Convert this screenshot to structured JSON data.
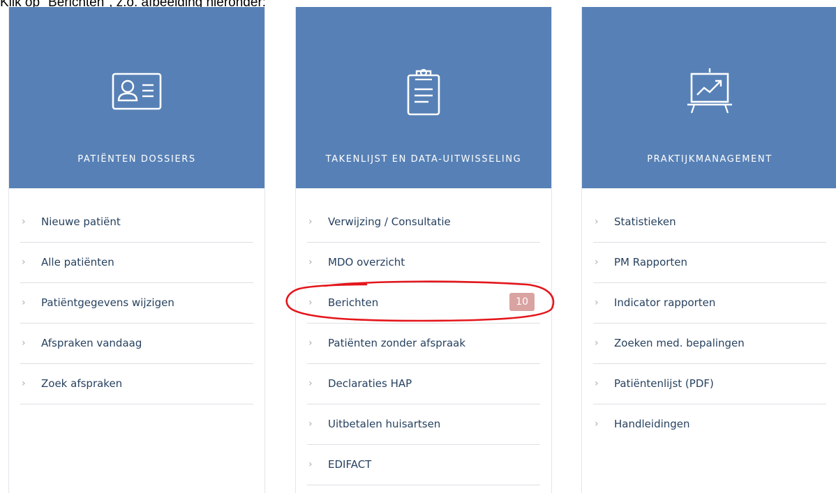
{
  "caption": "Klik op \"Berichten\", z.o. afbeelding hieronder:",
  "cards": [
    {
      "title": "PATIËNTEN DOSSIERS",
      "icon": "patient-id-card-icon",
      "items": [
        {
          "label": "Nieuwe patiënt"
        },
        {
          "label": "Alle patiënten"
        },
        {
          "label": "Patiëntgegevens wijzigen"
        },
        {
          "label": "Afspraken vandaag"
        },
        {
          "label": "Zoek afspraken"
        }
      ]
    },
    {
      "title": "TAKENLIJST EN DATA-UITWISSELING",
      "icon": "clipboard-icon",
      "items": [
        {
          "label": "Verwijzing / Consultatie"
        },
        {
          "label": "MDO overzicht"
        },
        {
          "label": "Berichten",
          "badge": "10"
        },
        {
          "label": "Patiënten zonder afspraak"
        },
        {
          "label": "Declaraties HAP"
        },
        {
          "label": "Uitbetalen huisartsen"
        },
        {
          "label": "EDIFACT"
        }
      ]
    },
    {
      "title": "PRAKTIJKMANAGEMENT",
      "icon": "presentation-chart-icon",
      "items": [
        {
          "label": "Statistieken"
        },
        {
          "label": "PM Rapporten"
        },
        {
          "label": "Indicator rapporten"
        },
        {
          "label": "Zoeken med. bepalingen"
        },
        {
          "label": "Patiëntenlijst (PDF)"
        },
        {
          "label": "Handleidingen"
        }
      ]
    }
  ],
  "colors": {
    "header_blue": "#5781b6",
    "item_text": "#27415f",
    "badge_bg": "#d9a3a2",
    "annotation_red": "#e4161b"
  }
}
